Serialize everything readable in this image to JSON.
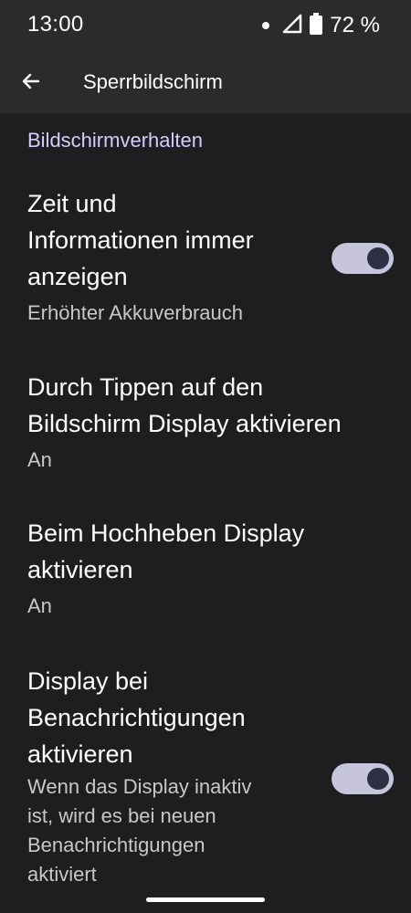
{
  "status_bar": {
    "time": "13:00",
    "battery_text": "72 %",
    "icons": [
      "notification-dot-icon",
      "signal-icon",
      "battery-icon"
    ]
  },
  "app_bar": {
    "back_icon": "arrow-back-icon",
    "title": "Sperrbildschirm"
  },
  "section": {
    "header": "Bildschirmverhalten"
  },
  "settings": [
    {
      "title_lines": [
        "Zeit und",
        "Informationen immer",
        "anzeigen"
      ],
      "summary_lines": [
        "Erhöhter Akkuverbrauch"
      ],
      "toggle": true,
      "toggle_on": true
    },
    {
      "title_lines": [
        "Durch Tippen auf den",
        "Bildschirm Display aktivieren"
      ],
      "summary_lines": [
        "An"
      ],
      "toggle": false
    },
    {
      "title_lines": [
        "Beim Hochheben Display",
        "aktivieren"
      ],
      "summary_lines": [
        "An"
      ],
      "toggle": false
    },
    {
      "title_lines": [
        "Display bei",
        "Benachrichtigungen",
        "aktivieren"
      ],
      "summary_lines": [
        "Wenn das Display inaktiv",
        "ist, wird es bei neuen",
        "Benachrichtigungen",
        "aktiviert"
      ],
      "toggle": true,
      "toggle_on": true
    }
  ],
  "colors": {
    "background": "#1e1e20",
    "top_bar": "#2b2b2d",
    "section_header": "#d4cdfa",
    "toggle_track": "#c7c5dc",
    "toggle_thumb": "#2e3142"
  }
}
